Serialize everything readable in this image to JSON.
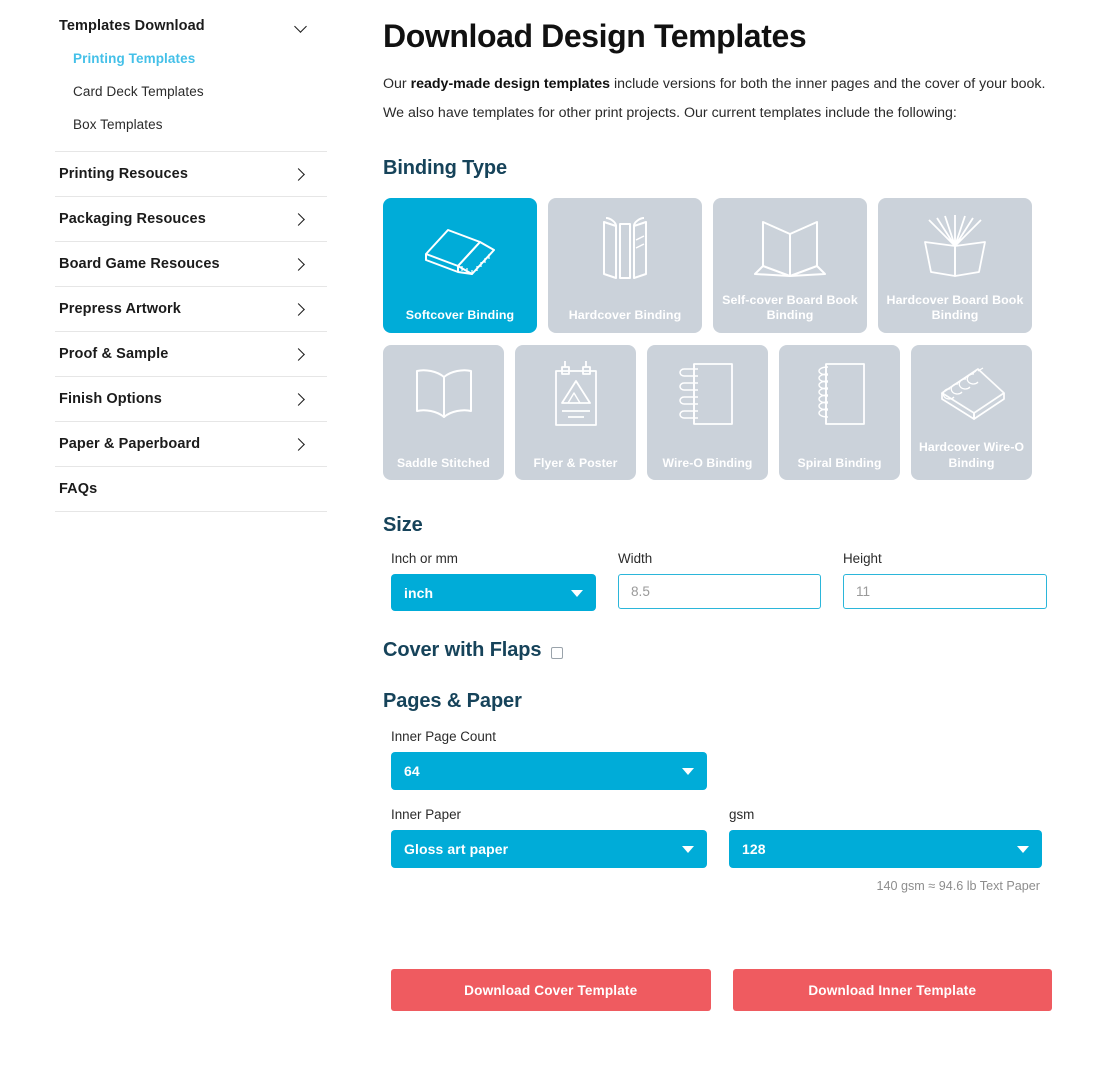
{
  "sidebar": {
    "group": {
      "title": "Templates Download",
      "chevron_icon": "chevron-down-icon",
      "sub_items": [
        {
          "label": "Printing Templates",
          "active": true
        },
        {
          "label": "Card Deck Templates",
          "active": false
        },
        {
          "label": "Box Templates",
          "active": false
        }
      ]
    },
    "items": [
      {
        "label": "Printing Resouces",
        "chevron": true
      },
      {
        "label": "Packaging Resouces",
        "chevron": true
      },
      {
        "label": "Board Game Resouces",
        "chevron": true
      },
      {
        "label": "Prepress Artwork",
        "chevron": true
      },
      {
        "label": "Proof & Sample",
        "chevron": true
      },
      {
        "label": "Finish Options",
        "chevron": true
      },
      {
        "label": "Paper & Paperboard",
        "chevron": true
      },
      {
        "label": "FAQs",
        "chevron": false
      }
    ]
  },
  "main": {
    "title": "Download Design Templates",
    "intro_line1_pre": "Our ",
    "intro_line1_bold": "ready-made design templates",
    "intro_line1_post": " include versions for both the inner pages and the cover of your book.",
    "intro_line2": "We also have templates for other print projects. Our current templates include the following:",
    "binding_section_title": "Binding Type",
    "binding_row1": [
      {
        "label": "Softcover Binding",
        "icon": "softcover-book-icon",
        "selected": true
      },
      {
        "label": "Hardcover Binding",
        "icon": "hardcover-book-icon",
        "selected": false
      },
      {
        "label": "Self-cover Board Book Binding",
        "icon": "self-cover-board-book-icon",
        "selected": false
      },
      {
        "label": "Hardcover Board Book Binding",
        "icon": "hardcover-board-book-icon",
        "selected": false
      }
    ],
    "binding_row2": [
      {
        "label": "Saddle Stitched",
        "icon": "open-book-icon",
        "selected": false
      },
      {
        "label": "Flyer & Poster",
        "icon": "poster-icon",
        "selected": false
      },
      {
        "label": "Wire-O Binding",
        "icon": "wire-o-notebook-icon",
        "selected": false
      },
      {
        "label": "Spiral Binding",
        "icon": "spiral-notebook-icon",
        "selected": false
      },
      {
        "label": "Hardcover Wire-O Binding",
        "icon": "hardcover-wire-o-icon",
        "selected": false
      }
    ],
    "size_section_title": "Size",
    "size": {
      "unit_label": "Inch or mm",
      "unit_value": "inch",
      "width_label": "Width",
      "width_placeholder": "8.5",
      "height_label": "Height",
      "height_placeholder": "11"
    },
    "flaps": {
      "label": "Cover with Flaps",
      "checked": false
    },
    "pages_section_title": "Pages & Paper",
    "pages": {
      "page_count_label": "Inner Page Count",
      "page_count_value": "64",
      "inner_paper_label": "Inner Paper",
      "inner_paper_value": "Gloss art paper",
      "gsm_label": "gsm",
      "gsm_value": "128",
      "gsm_note": "140 gsm ≈ 94.6 lb Text Paper"
    },
    "buttons": {
      "cover": "Download Cover Template",
      "inner": "Download Inner Template"
    }
  },
  "colors": {
    "accent_cyan": "#00acd8",
    "link_cyan": "#44c0e8",
    "card_gray": "#cbd2da",
    "heading_navy": "#16435a",
    "button_red": "#ef5b60"
  }
}
